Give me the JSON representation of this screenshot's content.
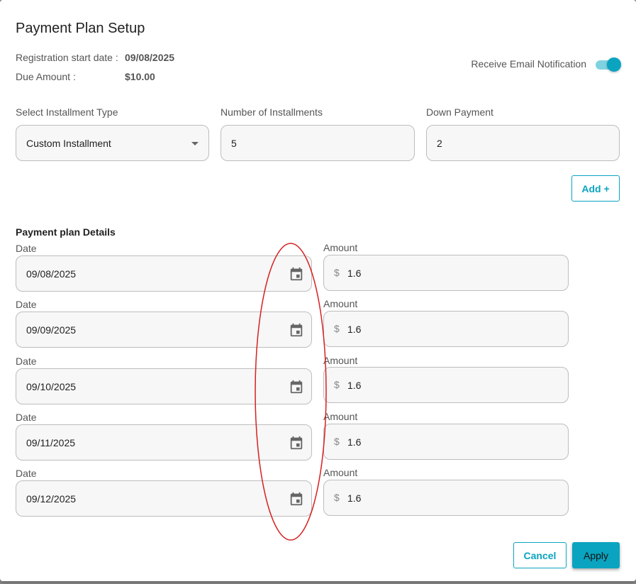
{
  "dialog": {
    "title": "Payment Plan Setup",
    "registration_label": "Registration start date :",
    "registration_value": "09/08/2025",
    "due_label": "Due Amount :",
    "due_value": "$10.00",
    "notification_label": "Receive Email Notification",
    "notification_enabled": true
  },
  "form": {
    "installment_type_label": "Select Installment Type",
    "installment_type_value": "Custom Installment",
    "num_installments_label": "Number of Installments",
    "num_installments_value": "5",
    "down_payment_label": "Down Payment",
    "down_payment_value": "2",
    "add_button": "Add +"
  },
  "plan": {
    "section_title": "Payment plan Details",
    "date_label": "Date",
    "amount_label": "Amount",
    "currency_symbol": "$",
    "rows": [
      {
        "date": "09/08/2025",
        "amount": "1.6"
      },
      {
        "date": "09/09/2025",
        "amount": "1.6"
      },
      {
        "date": "09/10/2025",
        "amount": "1.6"
      },
      {
        "date": "09/11/2025",
        "amount": "1.6"
      },
      {
        "date": "09/12/2025",
        "amount": "1.6"
      }
    ]
  },
  "actions": {
    "cancel": "Cancel",
    "apply": "Apply"
  },
  "colors": {
    "accent": "#0aa4c0",
    "annotation": "#d62020"
  },
  "icons": {
    "date_picker": "calendar-icon",
    "select": "caret-down-icon"
  }
}
